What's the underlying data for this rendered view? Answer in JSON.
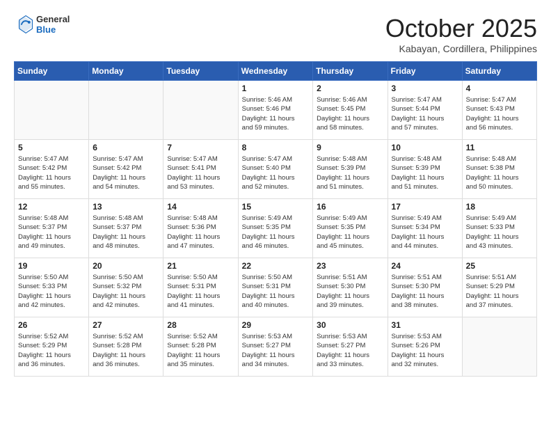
{
  "header": {
    "logo_general": "General",
    "logo_blue": "Blue",
    "month_title": "October 2025",
    "location": "Kabayan, Cordillera, Philippines"
  },
  "weekdays": [
    "Sunday",
    "Monday",
    "Tuesday",
    "Wednesday",
    "Thursday",
    "Friday",
    "Saturday"
  ],
  "weeks": [
    [
      {
        "day": "",
        "info": ""
      },
      {
        "day": "",
        "info": ""
      },
      {
        "day": "",
        "info": ""
      },
      {
        "day": "1",
        "info": "Sunrise: 5:46 AM\nSunset: 5:46 PM\nDaylight: 11 hours\nand 59 minutes."
      },
      {
        "day": "2",
        "info": "Sunrise: 5:46 AM\nSunset: 5:45 PM\nDaylight: 11 hours\nand 58 minutes."
      },
      {
        "day": "3",
        "info": "Sunrise: 5:47 AM\nSunset: 5:44 PM\nDaylight: 11 hours\nand 57 minutes."
      },
      {
        "day": "4",
        "info": "Sunrise: 5:47 AM\nSunset: 5:43 PM\nDaylight: 11 hours\nand 56 minutes."
      }
    ],
    [
      {
        "day": "5",
        "info": "Sunrise: 5:47 AM\nSunset: 5:42 PM\nDaylight: 11 hours\nand 55 minutes."
      },
      {
        "day": "6",
        "info": "Sunrise: 5:47 AM\nSunset: 5:42 PM\nDaylight: 11 hours\nand 54 minutes."
      },
      {
        "day": "7",
        "info": "Sunrise: 5:47 AM\nSunset: 5:41 PM\nDaylight: 11 hours\nand 53 minutes."
      },
      {
        "day": "8",
        "info": "Sunrise: 5:47 AM\nSunset: 5:40 PM\nDaylight: 11 hours\nand 52 minutes."
      },
      {
        "day": "9",
        "info": "Sunrise: 5:48 AM\nSunset: 5:39 PM\nDaylight: 11 hours\nand 51 minutes."
      },
      {
        "day": "10",
        "info": "Sunrise: 5:48 AM\nSunset: 5:39 PM\nDaylight: 11 hours\nand 51 minutes."
      },
      {
        "day": "11",
        "info": "Sunrise: 5:48 AM\nSunset: 5:38 PM\nDaylight: 11 hours\nand 50 minutes."
      }
    ],
    [
      {
        "day": "12",
        "info": "Sunrise: 5:48 AM\nSunset: 5:37 PM\nDaylight: 11 hours\nand 49 minutes."
      },
      {
        "day": "13",
        "info": "Sunrise: 5:48 AM\nSunset: 5:37 PM\nDaylight: 11 hours\nand 48 minutes."
      },
      {
        "day": "14",
        "info": "Sunrise: 5:48 AM\nSunset: 5:36 PM\nDaylight: 11 hours\nand 47 minutes."
      },
      {
        "day": "15",
        "info": "Sunrise: 5:49 AM\nSunset: 5:35 PM\nDaylight: 11 hours\nand 46 minutes."
      },
      {
        "day": "16",
        "info": "Sunrise: 5:49 AM\nSunset: 5:35 PM\nDaylight: 11 hours\nand 45 minutes."
      },
      {
        "day": "17",
        "info": "Sunrise: 5:49 AM\nSunset: 5:34 PM\nDaylight: 11 hours\nand 44 minutes."
      },
      {
        "day": "18",
        "info": "Sunrise: 5:49 AM\nSunset: 5:33 PM\nDaylight: 11 hours\nand 43 minutes."
      }
    ],
    [
      {
        "day": "19",
        "info": "Sunrise: 5:50 AM\nSunset: 5:33 PM\nDaylight: 11 hours\nand 42 minutes."
      },
      {
        "day": "20",
        "info": "Sunrise: 5:50 AM\nSunset: 5:32 PM\nDaylight: 11 hours\nand 42 minutes."
      },
      {
        "day": "21",
        "info": "Sunrise: 5:50 AM\nSunset: 5:31 PM\nDaylight: 11 hours\nand 41 minutes."
      },
      {
        "day": "22",
        "info": "Sunrise: 5:50 AM\nSunset: 5:31 PM\nDaylight: 11 hours\nand 40 minutes."
      },
      {
        "day": "23",
        "info": "Sunrise: 5:51 AM\nSunset: 5:30 PM\nDaylight: 11 hours\nand 39 minutes."
      },
      {
        "day": "24",
        "info": "Sunrise: 5:51 AM\nSunset: 5:30 PM\nDaylight: 11 hours\nand 38 minutes."
      },
      {
        "day": "25",
        "info": "Sunrise: 5:51 AM\nSunset: 5:29 PM\nDaylight: 11 hours\nand 37 minutes."
      }
    ],
    [
      {
        "day": "26",
        "info": "Sunrise: 5:52 AM\nSunset: 5:29 PM\nDaylight: 11 hours\nand 36 minutes."
      },
      {
        "day": "27",
        "info": "Sunrise: 5:52 AM\nSunset: 5:28 PM\nDaylight: 11 hours\nand 36 minutes."
      },
      {
        "day": "28",
        "info": "Sunrise: 5:52 AM\nSunset: 5:28 PM\nDaylight: 11 hours\nand 35 minutes."
      },
      {
        "day": "29",
        "info": "Sunrise: 5:53 AM\nSunset: 5:27 PM\nDaylight: 11 hours\nand 34 minutes."
      },
      {
        "day": "30",
        "info": "Sunrise: 5:53 AM\nSunset: 5:27 PM\nDaylight: 11 hours\nand 33 minutes."
      },
      {
        "day": "31",
        "info": "Sunrise: 5:53 AM\nSunset: 5:26 PM\nDaylight: 11 hours\nand 32 minutes."
      },
      {
        "day": "",
        "info": ""
      }
    ]
  ]
}
